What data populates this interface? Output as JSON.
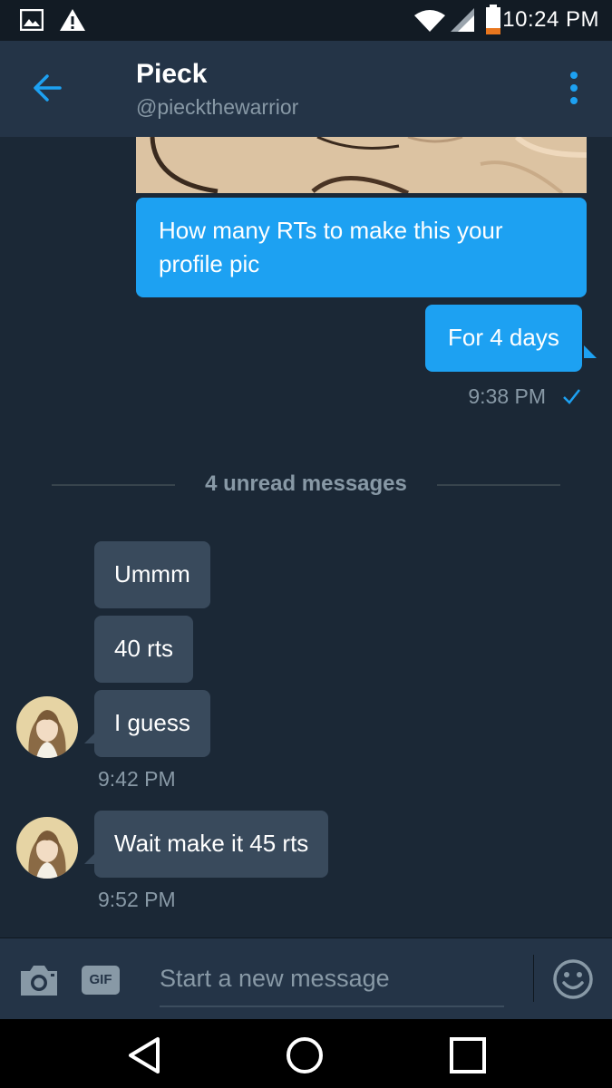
{
  "status_bar": {
    "time": "10:24 PM"
  },
  "header": {
    "title": "Pieck",
    "handle": "@pieckthewarrior"
  },
  "messages": [
    {
      "direction": "out",
      "text": "How many RTs to make this your profile pic"
    },
    {
      "direction": "out",
      "text": "For 4 days"
    },
    {
      "direction": "in",
      "text": "Ummm"
    },
    {
      "direction": "in",
      "text": "40 rts"
    },
    {
      "direction": "in",
      "text": "I guess"
    },
    {
      "direction": "in",
      "text": "Wait make it 45 rts"
    }
  ],
  "timestamps": {
    "sent": "9:38 PM",
    "received_1": "9:42 PM",
    "received_2": "9:52 PM"
  },
  "unread_divider": "4 unread messages",
  "composer": {
    "placeholder": "Start a new message",
    "gif_label": "GIF"
  },
  "icons": {
    "status": [
      "image-icon",
      "warning-icon",
      "wifi-icon",
      "signal-icon",
      "battery-icon"
    ],
    "header": [
      "back-arrow-icon",
      "more-vertical-icon"
    ],
    "composer": [
      "camera-icon",
      "gif-icon",
      "emoji-icon"
    ],
    "nav": [
      "nav-back-icon",
      "nav-home-icon",
      "nav-recent-icon"
    ]
  },
  "colors": {
    "accent": "#1da1f2",
    "background": "#1b2836",
    "header": "#243447",
    "incoming_bubble": "#394a5c",
    "muted_text": "#8899a6"
  }
}
